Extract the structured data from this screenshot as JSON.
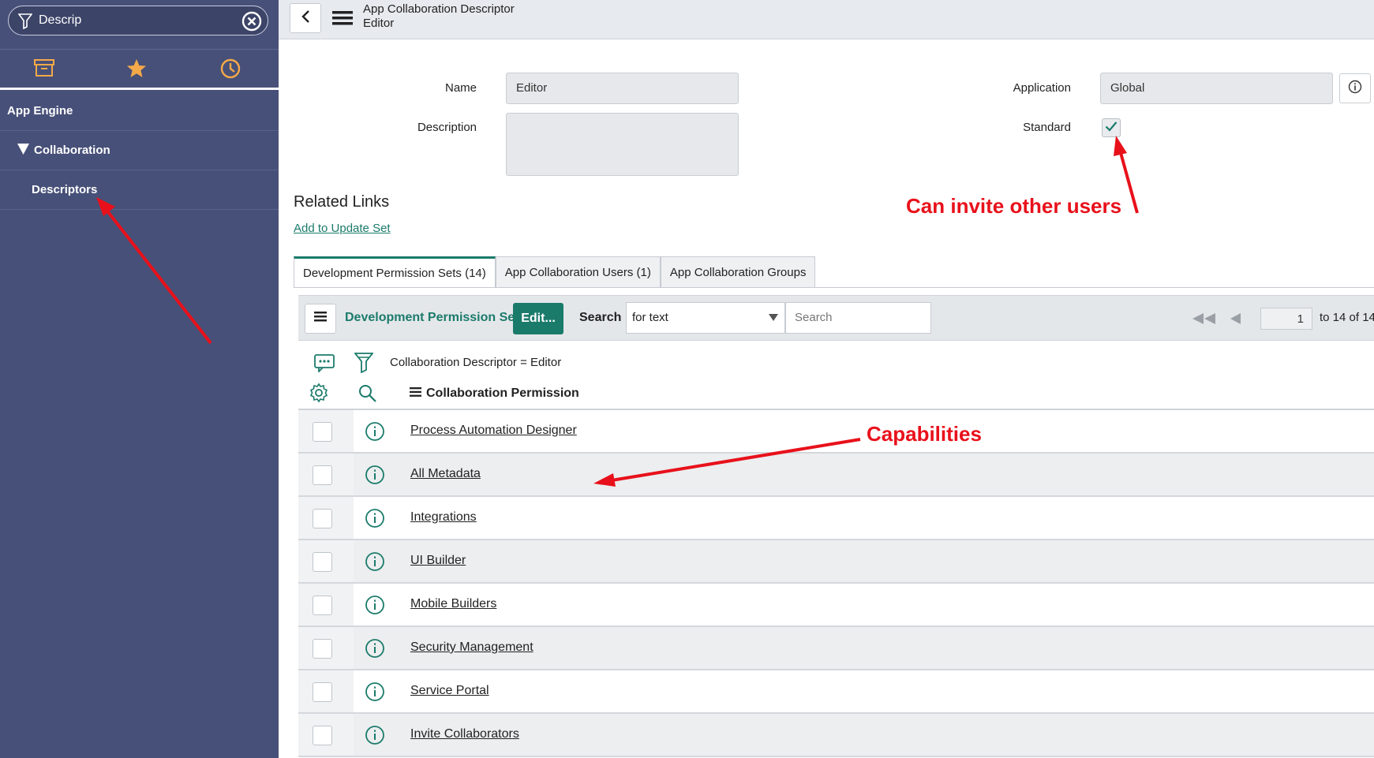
{
  "sidebar": {
    "filter_value": "Descrip",
    "tabs": [
      "archive-icon",
      "star-icon",
      "clock-icon"
    ],
    "items": [
      {
        "label": "App Engine"
      },
      {
        "label": "Collaboration"
      },
      {
        "label": "Descriptors"
      }
    ]
  },
  "header": {
    "title": "App Collaboration Descriptor",
    "subtitle": "Editor"
  },
  "form": {
    "name_label": "Name",
    "name_value": "Editor",
    "description_label": "Description",
    "description_value": "",
    "application_label": "Application",
    "application_value": "Global",
    "standard_label": "Standard",
    "standard_checked": true
  },
  "related_links": {
    "title": "Related Links",
    "add_to_update_set": "Add to Update Set"
  },
  "tabs": [
    {
      "label": "Development Permission Sets (14)",
      "active": true
    },
    {
      "label": "App Collaboration Users (1)",
      "active": false
    },
    {
      "label": "App Collaboration Groups",
      "active": false
    }
  ],
  "list": {
    "title": "Development Permission Sets",
    "edit_label": "Edit...",
    "search_label": "Search",
    "search_field_value": "for text",
    "search_placeholder": "Search",
    "page_number": "1",
    "page_total": "to 14 of 14",
    "filter_text": "Collaboration Descriptor = Editor",
    "column_header": "Collaboration Permission",
    "rows": [
      "Process Automation Designer",
      "All Metadata",
      "Integrations",
      "UI Builder",
      "Mobile Builders",
      "Security Management",
      "Service Portal",
      "Invite Collaborators"
    ]
  },
  "annotations": {
    "invite": "Can invite other users",
    "capabilities": "Capabilities"
  },
  "colors": {
    "sidebar": "#475078",
    "accent": "#1b7b6b",
    "annotation": "#e8111b",
    "star": "#f5a948"
  }
}
